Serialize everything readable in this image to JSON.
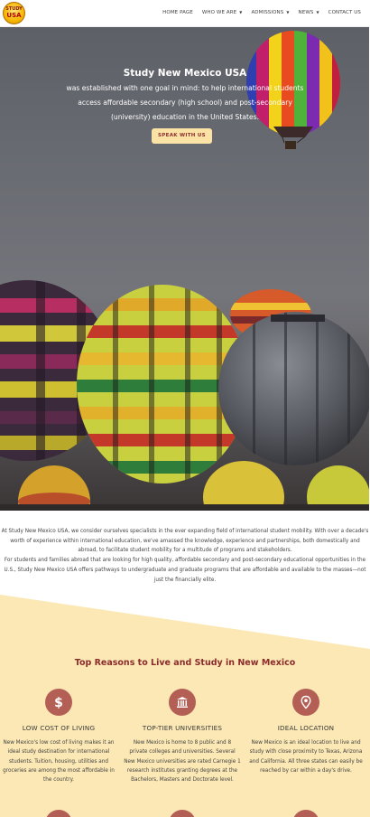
{
  "header": {
    "logo_top": "STUDY",
    "logo_bottom": "USA",
    "nav": [
      {
        "label": "HOME PAGE",
        "has_dropdown": false
      },
      {
        "label": "WHO WE ARE",
        "has_dropdown": true
      },
      {
        "label": "ADMISSIONS",
        "has_dropdown": true
      },
      {
        "label": "NEWS",
        "has_dropdown": true
      },
      {
        "label": "CONTACT US",
        "has_dropdown": false
      }
    ],
    "dropdown_caret": "▼"
  },
  "hero": {
    "title": "Study New Mexico USA",
    "subtitle": "was established with one goal in mind: to help international students access affordable secondary (high school) and post-secondary (university) education in the United States.",
    "button_label": "SPEAK WITH US"
  },
  "intro": {
    "paragraph1": "At Study New Mexico USA, we consider ourselves specialists in the ever expanding field of international student mobility. With over a decade's worth of experience within international education, we've amassed the knowledge, experience and partnerships, both domestically and abroad, to facilitate student mobility for a multitude of programs and stakeholders.",
    "paragraph2": "For students and families abroad that are looking for high quality, affordable secondary and post-secondary educational opportunities in the U.S., Study New Mexico USA offers pathways to undergraduate and graduate programs that are affordable and available to the masses—not just the financially elite."
  },
  "reasons": {
    "title": "Top Reasons to Live and Study in New Mexico",
    "items": [
      {
        "icon": "dollar-icon",
        "title": "LOW COST OF LIVING",
        "description": "New Mexico's low cost of living makes it an ideal study destination for international students. Tuition, housing, utilities and groceries are among the most affordable in the country."
      },
      {
        "icon": "university-building-icon",
        "title": "TOP-TIER UNIVERSITIES",
        "description": "New Mexico is home to 8 public and 8 private colleges and universities. Several New Mexico universities are rated Carnegie 1 research institutes granting degrees at the Bachelors, Masters and Doctorate level."
      },
      {
        "icon": "location-pin-icon",
        "title": "IDEAL LOCATION",
        "description": "New Mexico is an ideal location to live and study with close proximity to Texas, Arizona and California. All three states can easily be reached by car within a day's drive."
      }
    ]
  },
  "colors": {
    "accent_maroon": "#8b2c2c",
    "icon_circle": "#b45f55",
    "button_bg": "#fbe3a6",
    "section_bg": "#fbe8b4"
  }
}
